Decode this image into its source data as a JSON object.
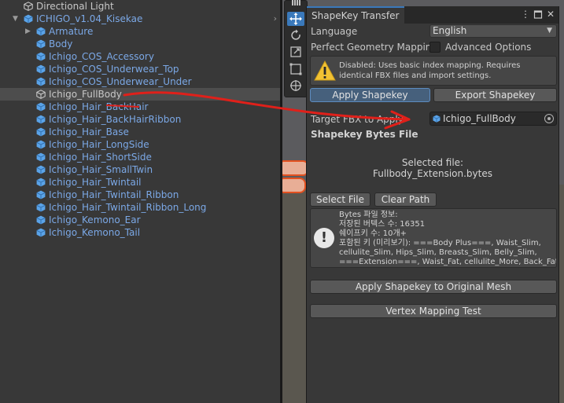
{
  "hierarchy": {
    "items": [
      {
        "label": "Directional Light",
        "kind": "plain",
        "indent": 30,
        "fold": ""
      },
      {
        "label": "ICHIGO_v1.04_Kisekae",
        "kind": "prefab",
        "indent": 30,
        "fold": "down",
        "chevron": true
      },
      {
        "label": "Armature",
        "kind": "prefab",
        "indent": 46,
        "fold": "right"
      },
      {
        "label": "Body",
        "kind": "prefab",
        "indent": 46,
        "fold": ""
      },
      {
        "label": "Ichigo_COS_Accessory",
        "kind": "prefab",
        "indent": 46,
        "fold": ""
      },
      {
        "label": "Ichigo_COS_Underwear_Top",
        "kind": "prefab",
        "indent": 46,
        "fold": ""
      },
      {
        "label": "Ichigo_COS_Underwear_Under",
        "kind": "prefab",
        "indent": 46,
        "fold": ""
      },
      {
        "label": "Ichigo_FullBody",
        "kind": "plain",
        "indent": 46,
        "fold": "",
        "selected": true
      },
      {
        "label": "Ichigo_Hair_BackHair",
        "kind": "prefab",
        "indent": 46,
        "fold": ""
      },
      {
        "label": "Ichigo_Hair_BackHairRibbon",
        "kind": "prefab",
        "indent": 46,
        "fold": ""
      },
      {
        "label": "Ichigo_Hair_Base",
        "kind": "prefab",
        "indent": 46,
        "fold": ""
      },
      {
        "label": "Ichigo_Hair_LongSide",
        "kind": "prefab",
        "indent": 46,
        "fold": ""
      },
      {
        "label": "Ichigo_Hair_ShortSide",
        "kind": "prefab",
        "indent": 46,
        "fold": ""
      },
      {
        "label": "Ichigo_Hair_SmallTwin",
        "kind": "prefab",
        "indent": 46,
        "fold": ""
      },
      {
        "label": "Ichigo_Hair_Twintail",
        "kind": "prefab",
        "indent": 46,
        "fold": ""
      },
      {
        "label": "Ichigo_Hair_Twintail_Ribbon",
        "kind": "prefab",
        "indent": 46,
        "fold": ""
      },
      {
        "label": "Ichigo_Hair_Twintail_Ribbon_Long",
        "kind": "prefab",
        "indent": 46,
        "fold": ""
      },
      {
        "label": "Ichigo_Kemono_Ear",
        "kind": "prefab",
        "indent": 46,
        "fold": ""
      },
      {
        "label": "Ichigo_Kemono_Tail",
        "kind": "prefab",
        "indent": 46,
        "fold": ""
      }
    ]
  },
  "scene_tools": [
    "hand-tool",
    "move-tool",
    "rotate-tool",
    "scale-tool",
    "rect-tool",
    "transform-tool"
  ],
  "window": {
    "tab_title": "ShapeKey Transfer",
    "language_label": "Language",
    "language_value": "English",
    "perfect_mapping_label": "Perfect Geometry Mapping",
    "perfect_mapping_checked": false,
    "advanced_label": "Advanced Options",
    "advanced_checked": false,
    "warning_text": "Disabled: Uses basic index mapping. Requires identical FBX files and import settings.",
    "apply_tab_label": "Apply Shapekey",
    "export_tab_label": "Export Shapekey",
    "target_label": "Target FBX to Apply",
    "target_value": "Ichigo_FullBody",
    "bytes_section_title": "Shapekey Bytes File",
    "selected_file_label": "Selected file:",
    "selected_file_name": "Fullbody_Extension.bytes",
    "select_file_label": "Select File",
    "clear_path_label": "Clear Path",
    "info_lines": [
      "Bytes 파일 정보:",
      "저장된 버텍스 수: 16351",
      "쉐이프키 수: 10개+",
      "포함된 키 (미리보기): ===Body Plus===, Waist_Slim,",
      "cellulite_Slim, Hips_Slim, Breasts_Slim, Belly_Slim,",
      "===Extension===, Waist_Fat, cellulite_More, Back_Fat"
    ],
    "apply_original_label": "Apply Shapekey to Original Mesh",
    "vertex_test_label": "Vertex Mapping Test"
  },
  "colors": {
    "accent": "#3a79bb",
    "prefab_text": "#7ba8e6",
    "annotation_red": "#e0201a",
    "object_outline": "#e2501f"
  }
}
